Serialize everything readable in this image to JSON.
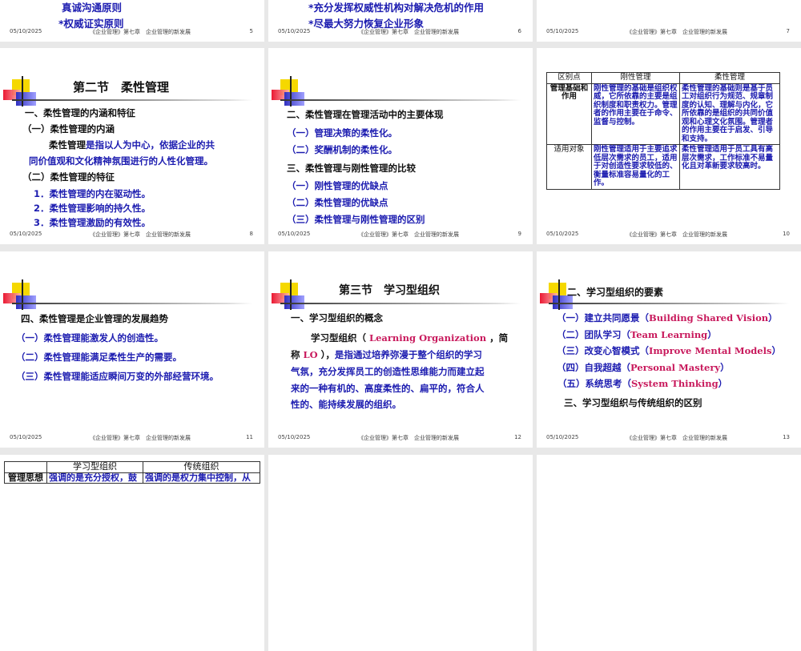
{
  "footer": {
    "date": "05/10/2025",
    "course": "《企业管理》第七章　企业管理的新发展"
  },
  "slides": {
    "s5": {
      "number": "5",
      "lines": [
        "真诚沟通原则",
        "*权威证实原则"
      ]
    },
    "s6": {
      "number": "6",
      "lines": [
        "*充分发挥权威性机构对解决危机的作用",
        "*尽最大努力恢复企业形象"
      ]
    },
    "s7": {
      "number": "7"
    },
    "s8": {
      "number": "8",
      "title": "第二节　柔性管理",
      "lines": [
        "一、柔性管理的内涵和特征",
        "（一）柔性管理的内涵",
        "柔性管理",
        "是指以人为中心，依据企业的共",
        "同价值观和文化精神氛围进行的人性化管理。",
        "（二）柔性管理的特征",
        "1．柔性管理的内在驱动性。",
        "2．柔性管理影响的持久性。",
        "3．柔性管理激励的有效性。"
      ]
    },
    "s9": {
      "number": "9",
      "lines": [
        "二、柔性管理在管理活动中的主要体现",
        "（一）管理决策的柔性化。",
        "（二）奖酬机制的柔性化。",
        "三、柔性管理与刚性管理的比较",
        "（一）刚性管理的优缺点",
        "（二）柔性管理的优缺点",
        "（三）柔性管理与刚性管理的区别"
      ]
    },
    "s10": {
      "number": "10",
      "table": {
        "headers": [
          "区别点",
          "刚性管理",
          "柔性管理"
        ],
        "rows": [
          [
            "管理基础和作用",
            "刚性管理的基础是组织权威，它所依靠的主要是组织制度和职责权力。管理者的作用主要在于命令、监督与控制。",
            "柔性管理的基础则是基于员工对组织行为规范、规章制度的认知、理解与内化，它所依靠的是组织的共同价值观和心理文化氛围。管理者的作用主要在于启发、引导和支持。"
          ],
          [
            "适用对象",
            "刚性管理适用于主要追求低层次需求的员工，适用于对创造性要求较低的、衡量标准容易量化的工作。",
            "柔性管理适用于员工具有高层次需求，工作标准不易量化且对革新要求较高时。"
          ]
        ]
      }
    },
    "s11": {
      "number": "11",
      "lines": [
        "四、柔性管理是企业管理的发展趋势",
        "（一）柔性管理能激发人的创造性。",
        "（二）柔性管理能满足柔性生产的需要。",
        "（三）柔性管理能适应瞬间万变的外部经营环境。"
      ]
    },
    "s12": {
      "number": "12",
      "title": "第三节　学习型组织",
      "lines": [
        "一、学习型组织的概念",
        "学习型组织（",
        "Learning Organization",
        "，简",
        "称",
        "LO",
        "），",
        "是指通过培养弥漫于整个组织的学习",
        "气氛，充分发挥员工的创造性思维能力而建立起",
        "来的一种有机的、高度柔性的、扁平的，符合人",
        "性的、能持续发展的组织。"
      ]
    },
    "s13": {
      "number": "13",
      "title": "二、学习型组织的要素",
      "items": [
        {
          "cn": "（一）建立共同愿景（",
          "en": "Building Shared Vision",
          "end": "）"
        },
        {
          "cn": "（二）团队学习（",
          "en": "Team Learning",
          "end": "）"
        },
        {
          "cn": "（三）改变心智模式（",
          "en": "Improve Mental Models",
          "end": "）"
        },
        {
          "cn": "（四）自我超越（",
          "en": "Personal Mastery",
          "end": "）"
        },
        {
          "cn": "（五）系统思考（",
          "en": "System Thinking",
          "end": "）"
        }
      ],
      "last": "三、学习型组织与传统组织的区别"
    },
    "s14": {
      "table": {
        "headers": [
          "",
          "学习型组织",
          "传统组织"
        ],
        "row": [
          "管理思想",
          "强调的是充分授权，鼓",
          "强调的是权力集中控制，从"
        ]
      }
    }
  },
  "colors": {
    "blue": "#1c1cb0",
    "pink": "#c8195c",
    "background": "#e8e8e8"
  }
}
